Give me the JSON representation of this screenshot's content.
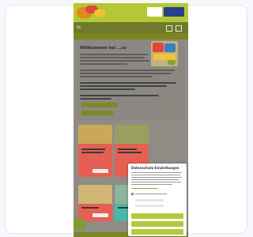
{
  "site": {
    "subnav_label": "DE",
    "welcome_heading": "Willkommen bei ...zu",
    "cookie_title": "Datenschutz-Einstellungen"
  },
  "colors": {
    "brand_green": "#b5c734",
    "dark_green": "#7b8620",
    "tile_red": "#e56052",
    "tile_teal": "#4cb7a8"
  },
  "icons": [
    "logo-icon",
    "menu-icon",
    "user-icon",
    "search-icon"
  ]
}
